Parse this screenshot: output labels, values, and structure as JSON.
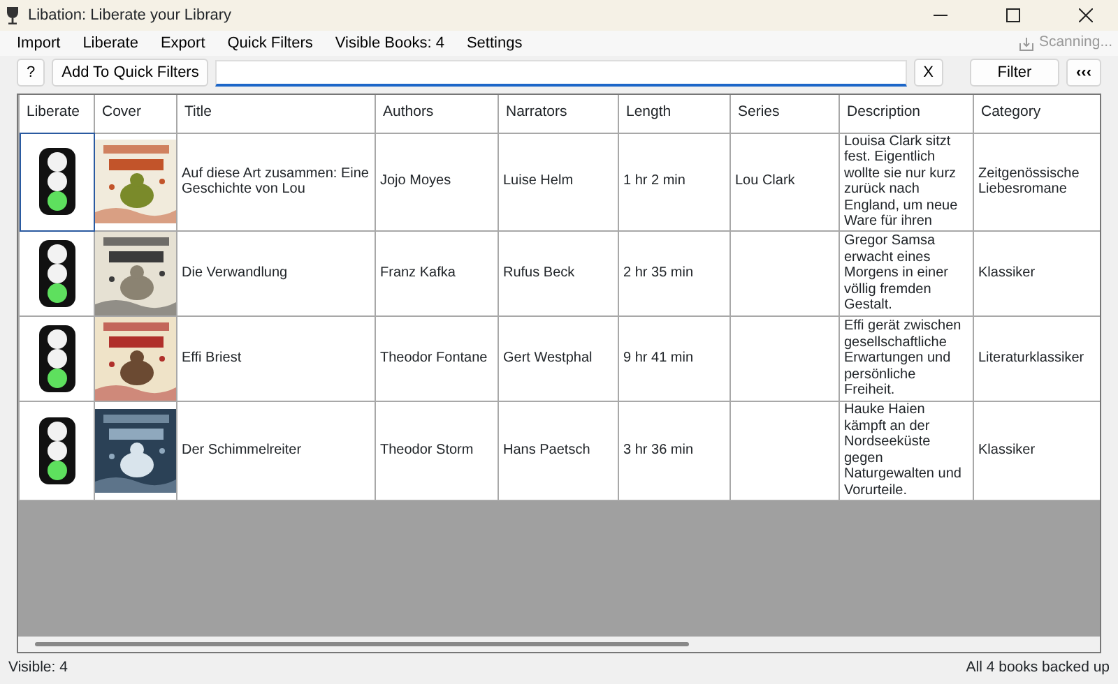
{
  "window": {
    "title": "Libation: Liberate your Library"
  },
  "menu": [
    "Import",
    "Liberate",
    "Export",
    "Quick Filters",
    "Visible Books: 4",
    "Settings"
  ],
  "scan_status": {
    "label": "Scanning...",
    "disabled": true
  },
  "toolbar": {
    "help_button": "?",
    "add_button": "Add To Quick Filters",
    "search": {
      "focused": true
    },
    "clear_button": "X",
    "filter_button": "Filter",
    "collapse_button": "‹‹‹"
  },
  "table": {
    "columns": [
      "Liberate",
      "Cover",
      "Title",
      "Authors",
      "Narrators",
      "Length",
      "Series",
      "Description",
      "Category"
    ],
    "rows": [
      {
        "liberated": true,
        "focused": true,
        "title": "Auf diese Art zusammen: Eine Geschichte von Lou",
        "authors": "Jojo Moyes",
        "narrators": "Luise Helm",
        "length": "1 hr 2 min",
        "series": "Lou Clark",
        "description": "Louisa Clark sitzt fest. Eigentlich wollte sie nur kurz zurück nach England, um neue Ware für ihren",
        "category": "Zeitgenössische Liebesromane"
      },
      {
        "liberated": true,
        "focused": false,
        "title": "Die Verwandlung",
        "authors": "Franz Kafka",
        "narrators": "Rufus Beck",
        "length": "2 hr 35 min",
        "description": "Gregor Samsa erwacht eines Morgens in einer völlig fremden Gestalt.",
        "category": "Klassiker"
      },
      {
        "liberated": true,
        "focused": false,
        "title": "Effi Briest",
        "authors": "Theodor Fontane",
        "narrators": "Gert Westphal",
        "length": "9 hr 41 min",
        "description": "Effi gerät zwischen gesellschaftliche Erwartungen und persönliche Freiheit.",
        "category": "Literaturklassiker"
      },
      {
        "liberated": true,
        "focused": false,
        "title": "Der Schimmelreiter",
        "authors": "Theodor Storm",
        "narrators": "Hans Paetsch",
        "length": "3 hr 36 min",
        "description": "Hauke Haien kämpft an der Nordseeküste gegen Naturgewalten und Vorurteile.",
        "category": "Klassiker"
      }
    ]
  },
  "status_bar": {
    "left": "Visible: 4",
    "right": "All 4 books backed up"
  }
}
